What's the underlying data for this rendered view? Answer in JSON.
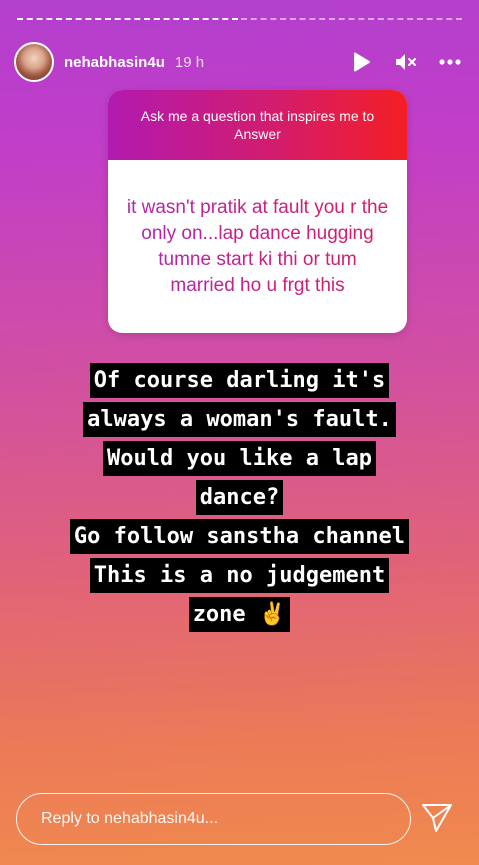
{
  "story": {
    "username": "nehabhasin4u",
    "time": "19 h",
    "segments_total": 2,
    "segments_viewed": 1
  },
  "question_card": {
    "prompt": "Ask me a question that inspires me to Answer",
    "answer": "it wasn't pratik at fault you r the only on...lap dance hugging tumne start ki thi or tum married ho u frgt this"
  },
  "caption_lines": [
    "Of course darling it's",
    "always a woman's fault.",
    "Would you like a lap",
    "dance?",
    "Go follow sanstha channel",
    "This is a no judgement",
    "zone ✌️"
  ],
  "reply": {
    "placeholder": "Reply to nehabhasin4u..."
  },
  "icons": {
    "play": "play-icon",
    "mute": "speaker-muted-icon",
    "more": "more-icon",
    "send": "send-icon"
  },
  "colors": {
    "card_gradient_start": "#b21ab0",
    "card_gradient_end": "#f41f24"
  }
}
